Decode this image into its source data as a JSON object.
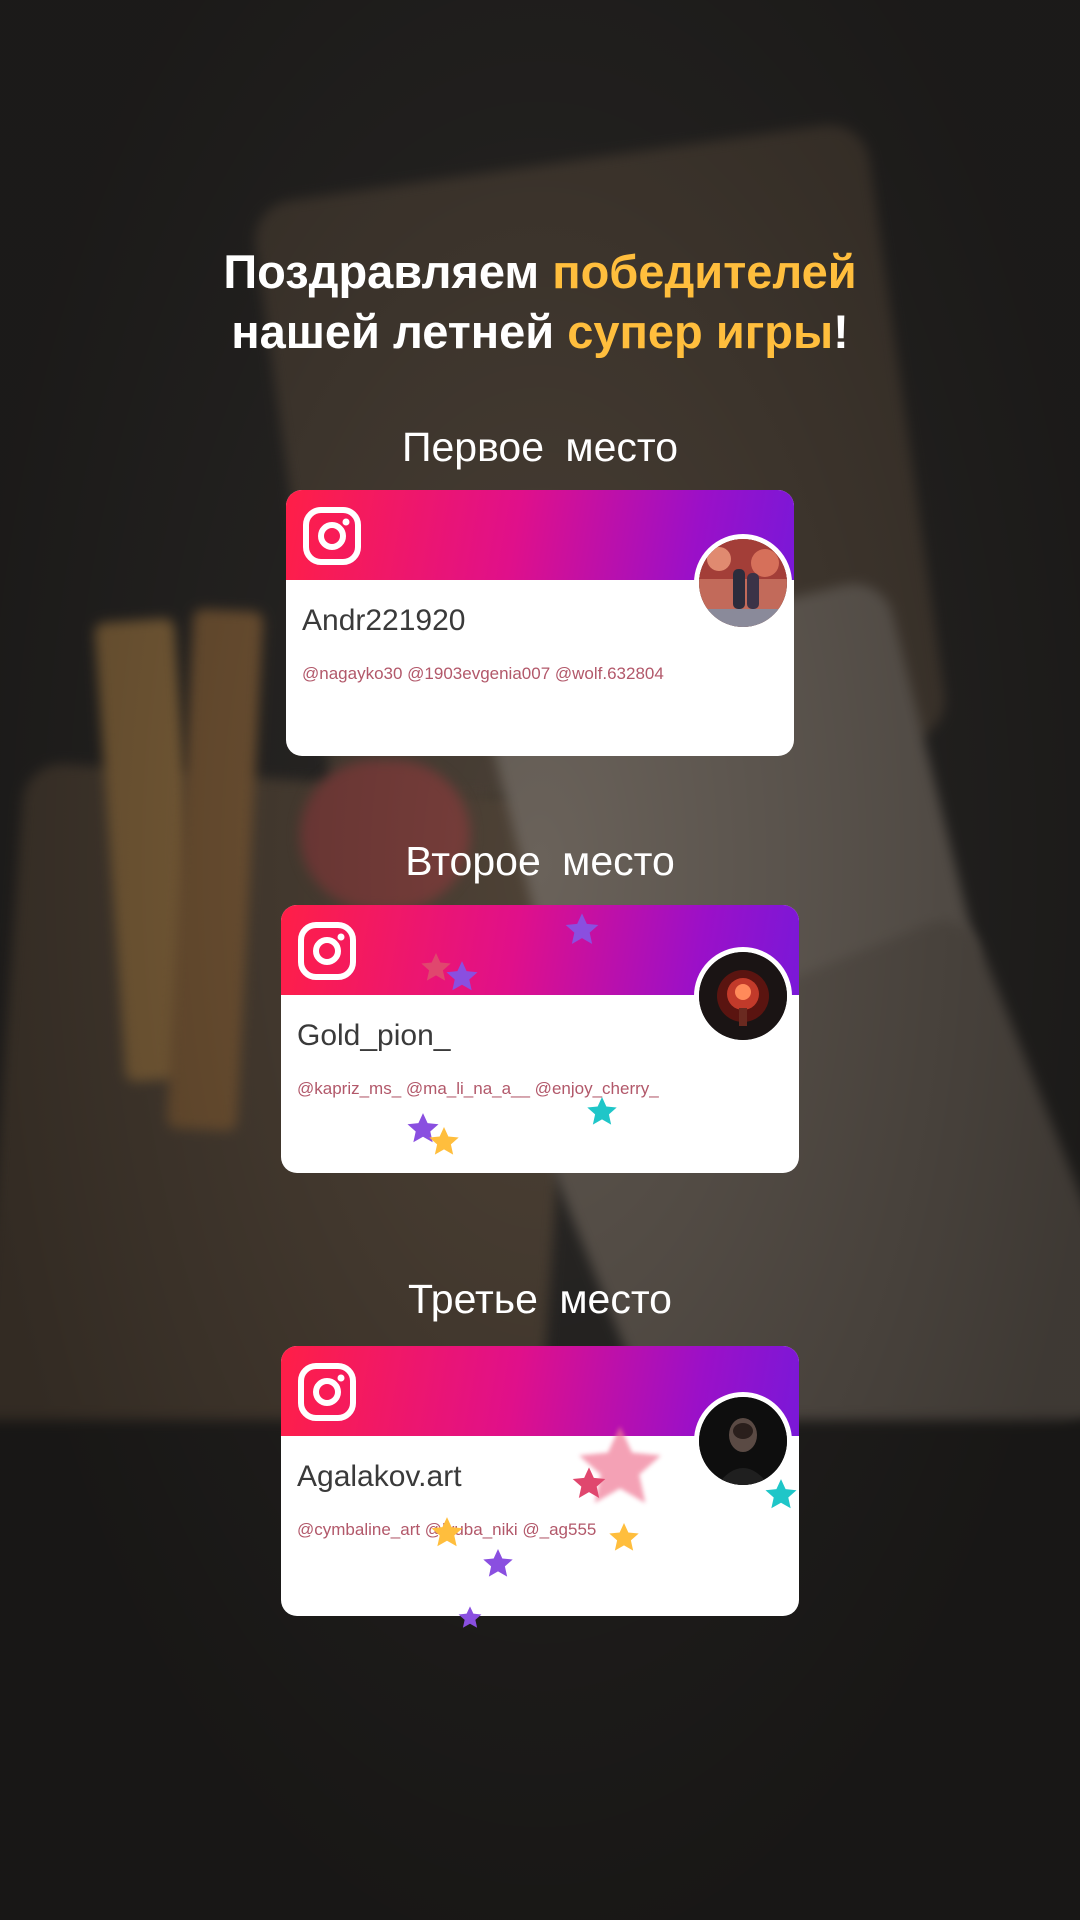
{
  "headline": {
    "line1_part1": "Поздравляем ",
    "line1_accent": "победителей",
    "line2_part1": "нашей летней ",
    "line2_accent": "супер игры",
    "line2_end": "!"
  },
  "colors": {
    "accent": "#ffbe3d",
    "gradient_start": "#ff1f47",
    "gradient_end": "#7a18d8",
    "mention_text": "#b2586a"
  },
  "winners": [
    {
      "place": "Первое  место",
      "username": "Andr221920",
      "mentions": "@nagayko30 @1903evgenia007 @wolf.632804",
      "icon": "instagram-icon"
    },
    {
      "place": "Второе  место",
      "username": "Gold_pion_",
      "mentions": "@kapriz_ms_ @ma_li_na_a__ @enjoy_cherry_",
      "icon": "instagram-icon"
    },
    {
      "place": "Третье  место",
      "username": "Agalakov.art",
      "mentions": "@cymbaline_art @lyuba_niki @_ag555",
      "icon": "instagram-icon"
    }
  ]
}
